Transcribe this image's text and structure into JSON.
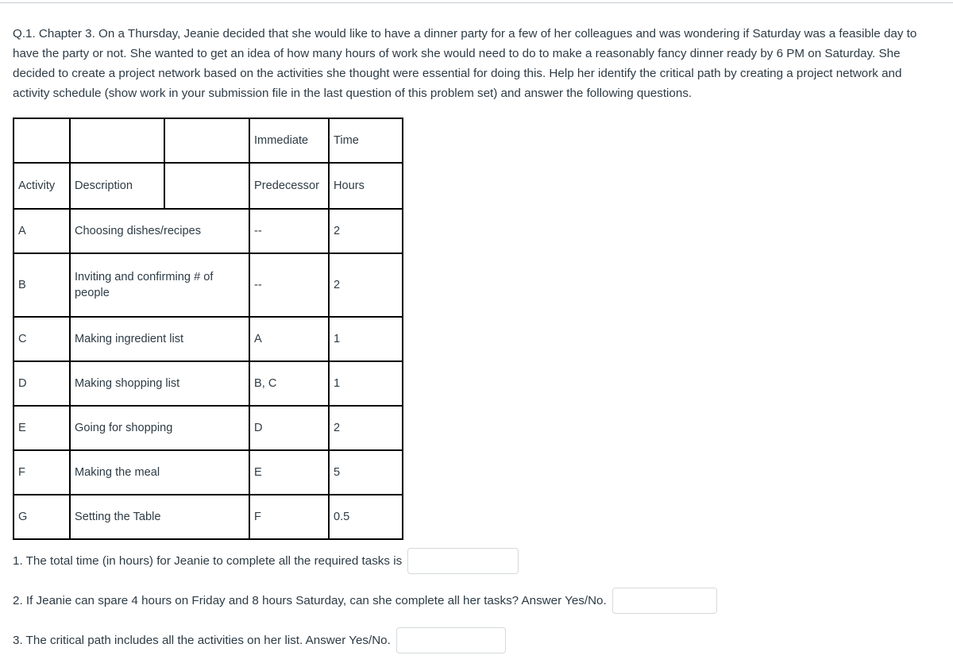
{
  "prompt": {
    "text": "Q.1. Chapter 3. On a Thursday, Jeanie decided that she would like to have a dinner party for a few of her colleagues and was wondering if Saturday was a feasible day to have the party or not. She wanted to get an idea of how many hours of work she would need to do to make a reasonably fancy dinner ready by 6 PM on Saturday. She decided to create a project network based on the activities she thought were essential for doing this. Help her identify the critical path by creating a project network and activity schedule (show work in your submission file in the last question of this problem set) and answer the following questions."
  },
  "table": {
    "header_row_1": [
      "",
      "",
      "",
      "Immediate",
      "Time"
    ],
    "header_row_2": [
      "Activity",
      "Description",
      "",
      "Predecessor",
      "Hours"
    ],
    "rows": [
      {
        "activity": "A",
        "description": "Choosing dishes/recipes",
        "predecessor": "--",
        "hours": "2"
      },
      {
        "activity": "B",
        "description": "Inviting and confirming # of people",
        "predecessor": "--",
        "hours": "2"
      },
      {
        "activity": "C",
        "description": "Making ingredient list",
        "predecessor": "A",
        "hours": "1"
      },
      {
        "activity": "D",
        "description": "Making shopping list",
        "predecessor": "B, C",
        "hours": "1"
      },
      {
        "activity": "E",
        "description": "Going for shopping",
        "predecessor": "D",
        "hours": "2"
      },
      {
        "activity": "F",
        "description": "Making the meal",
        "predecessor": "E",
        "hours": "5"
      },
      {
        "activity": "G",
        "description": "Setting the Table",
        "predecessor": "F",
        "hours": "0.5"
      }
    ]
  },
  "questions": [
    {
      "text": "1. The total time (in hours) for Jeanie to complete all the required tasks is",
      "answer_value": "",
      "answer_placeholder": ""
    },
    {
      "text": "2. If Jeanie can spare 4 hours on Friday and 8 hours Saturday, can she complete all her tasks? Answer Yes/No.",
      "answer_value": "",
      "answer_placeholder": ""
    },
    {
      "text": "3. The critical path includes all the activities on her list. Answer Yes/No.",
      "answer_value": "",
      "answer_placeholder": ""
    }
  ],
  "colors": {
    "text": "#2d3b45",
    "table_border": "#000000",
    "input_border": "#d5d9dc",
    "top_rule": "#c7cdd1",
    "background": "#ffffff"
  }
}
